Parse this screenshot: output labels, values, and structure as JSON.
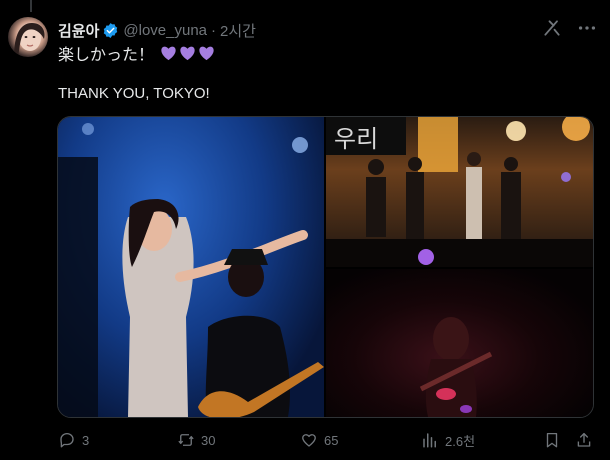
{
  "post": {
    "author_name": "김윤아",
    "handle": "@love_yuna",
    "separator": "·",
    "time": "2시간",
    "text_line1": "楽しかった！",
    "text_line2": "THANK YOU, TOKYO!",
    "hearts": [
      "purple-heart",
      "purple-heart",
      "purple-heart"
    ]
  },
  "media": {
    "right_top_sign": "우리"
  },
  "actions": {
    "replies": "3",
    "reposts": "30",
    "likes": "65",
    "views": "2.6천"
  },
  "colors": {
    "background": "#000000",
    "text": "#e7e9ea",
    "muted": "#71767b",
    "verified": "#1d9bf0",
    "heart": "#a57ee0"
  },
  "icons": [
    "verified-badge-icon",
    "grok-icon",
    "more-icon",
    "reply-icon",
    "retweet-icon",
    "like-icon",
    "views-icon",
    "bookmark-icon",
    "share-icon"
  ]
}
